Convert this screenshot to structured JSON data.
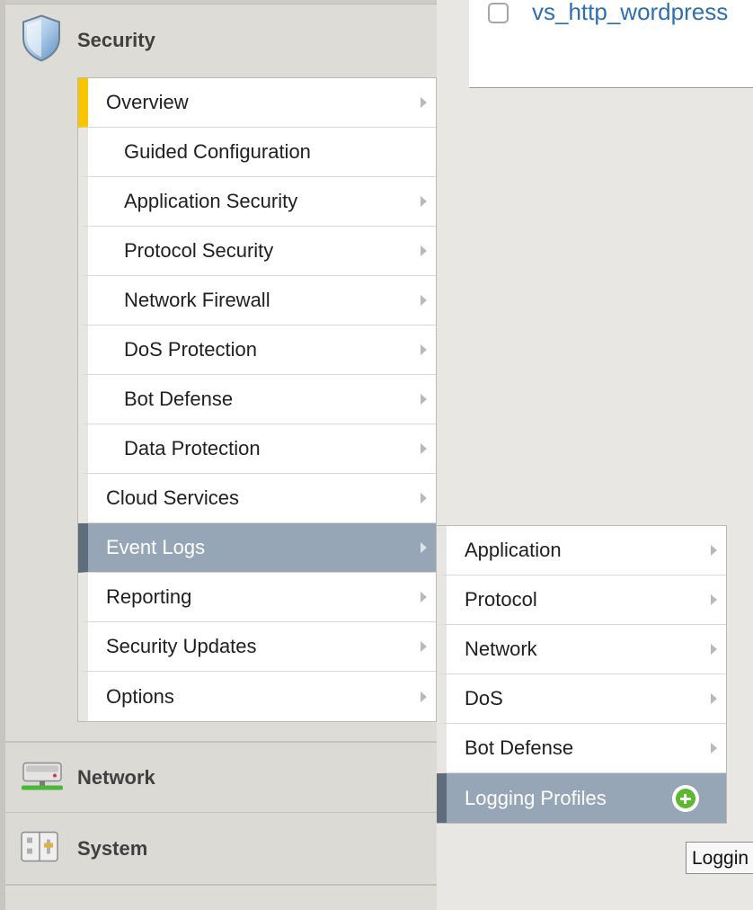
{
  "nav": {
    "security": {
      "label": "Security",
      "icon": "shield-icon"
    },
    "network": {
      "label": "Network",
      "icon": "network-device-icon"
    },
    "system": {
      "label": "System",
      "icon": "system-panel-icon"
    }
  },
  "security_menu": {
    "items": [
      {
        "label": "Overview",
        "has_submenu": true,
        "state": "current"
      },
      {
        "label": "Guided Configuration",
        "has_submenu": false
      },
      {
        "label": "Application Security",
        "has_submenu": true
      },
      {
        "label": "Protocol Security",
        "has_submenu": true
      },
      {
        "label": "Network Firewall",
        "has_submenu": true
      },
      {
        "label": "DoS Protection",
        "has_submenu": true
      },
      {
        "label": "Bot Defense",
        "has_submenu": true
      },
      {
        "label": "Data Protection",
        "has_submenu": true
      },
      {
        "label": "Cloud Services",
        "has_submenu": true
      },
      {
        "label": "Event Logs",
        "has_submenu": true,
        "state": "active"
      },
      {
        "label": "Reporting",
        "has_submenu": true
      },
      {
        "label": "Security Updates",
        "has_submenu": true
      },
      {
        "label": "Options",
        "has_submenu": true
      }
    ]
  },
  "event_logs_menu": {
    "items": [
      {
        "label": "Application",
        "has_submenu": true
      },
      {
        "label": "Protocol",
        "has_submenu": true
      },
      {
        "label": "Network",
        "has_submenu": true
      },
      {
        "label": "DoS",
        "has_submenu": true
      },
      {
        "label": "Bot Defense",
        "has_submenu": true
      },
      {
        "label": "Logging Profiles",
        "has_submenu": false,
        "state": "active",
        "action_icon": "plus-circle-icon"
      }
    ]
  },
  "content": {
    "virtual_server_link": "vs_http_wordpress",
    "checkbox_checked": false
  },
  "tooltip": {
    "text": "Loggin"
  },
  "colors": {
    "accent_current": "#f7c600",
    "active_bg": "#97a6b6",
    "link": "#2f6fab",
    "add_button": "#5cb82e"
  }
}
